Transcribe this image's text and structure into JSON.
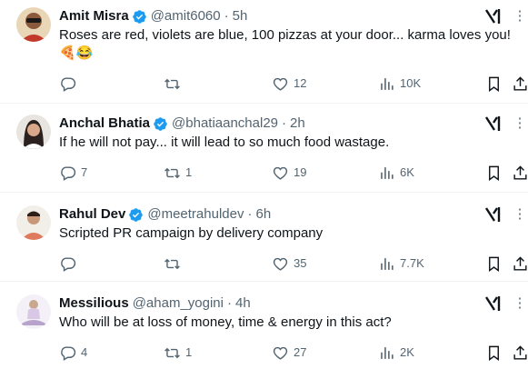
{
  "tweets": [
    {
      "name": "Amit Misra",
      "handle": "@amit6060",
      "time": "5h",
      "text": "Roses are red, violets are blue, 100 pizzas at your door... karma loves you!",
      "emoji": "🍕😂",
      "replies": "",
      "retweets": "",
      "likes": "12",
      "views": "10K",
      "avatar_color": "#c0392b"
    },
    {
      "name": "Anchal Bhatia",
      "handle": "@bhatiaanchal29",
      "time": "2h",
      "text": "If he will not pay... it will lead to so much food wastage.",
      "emoji": "",
      "replies": "7",
      "retweets": "1",
      "likes": "19",
      "views": "6K",
      "avatar_color": "#6b5a4e"
    },
    {
      "name": "Rahul Dev",
      "handle": "@meetrahuldev",
      "time": "6h",
      "text": "Scripted PR campaign by delivery company",
      "emoji": "",
      "replies": "",
      "retweets": "",
      "likes": "35",
      "views": "7.7K",
      "avatar_color": "#e07a5f"
    },
    {
      "name": "Messilious",
      "handle": "@aham_yogini",
      "time": "4h",
      "text": "Who will be at loss of money, time & energy in this act?",
      "emoji": "",
      "replies": "4",
      "retweets": "1",
      "likes": "27",
      "views": "2K",
      "avatar_color": "#d9c7e6"
    }
  ],
  "separator": "·",
  "more_glyph": "⋮",
  "colors": {
    "verified": "#1d9bf0",
    "text": "#0f1419",
    "secondary": "#536471",
    "divider": "#eff3f4"
  },
  "icons": {
    "reply": "reply-icon",
    "retweet": "retweet-icon",
    "like": "heart-icon",
    "views": "views-icon",
    "bookmark": "bookmark-icon",
    "share": "share-icon",
    "grok": "grok-icon",
    "verified": "verified-badge-icon"
  }
}
